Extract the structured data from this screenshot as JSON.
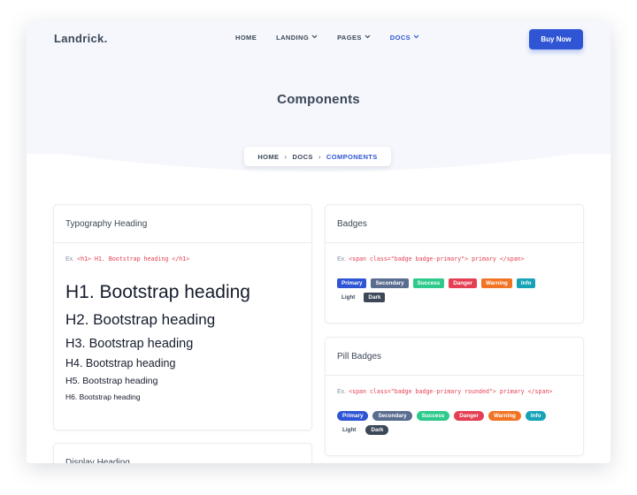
{
  "nav": {
    "logo": "Landrick.",
    "items": [
      {
        "label": "HOME",
        "dropdown": false,
        "active": false
      },
      {
        "label": "LANDING",
        "dropdown": true,
        "active": false
      },
      {
        "label": "PAGES",
        "dropdown": true,
        "active": false
      },
      {
        "label": "DOCS",
        "dropdown": true,
        "active": true
      }
    ],
    "cta": "Buy Now"
  },
  "page": {
    "title": "Components"
  },
  "breadcrumb": {
    "items": [
      "HOME",
      "DOCS",
      "COMPONENTS"
    ],
    "separator": "›"
  },
  "typography": {
    "title": "Typography Heading",
    "example_prefix": "Ex.",
    "example_code": "<h1> H1. Bootstrap heading </h1>",
    "headings": [
      "H1. Bootstrap heading",
      "H2. Bootstrap heading",
      "H3. Bootstrap heading",
      "H4. Bootstrap heading",
      "H5. Bootstrap heading",
      "H6. Bootstrap heading"
    ]
  },
  "display_card": {
    "title": "Display Heading"
  },
  "badges": {
    "title": "Badges",
    "example_prefix": "Ex.",
    "example_code": "<span class=\"badge badge-primary\"> primary </span>",
    "items": [
      {
        "label": "Primary",
        "color": "#2f55d4"
      },
      {
        "label": "Secondary",
        "color": "#5a6d90"
      },
      {
        "label": "Success",
        "color": "#2eca8b"
      },
      {
        "label": "Danger",
        "color": "#e43f52"
      },
      {
        "label": "Warning",
        "color": "#f17425"
      },
      {
        "label": "Info",
        "color": "#17a2b8"
      },
      {
        "label": "Light",
        "color": "transparent"
      },
      {
        "label": "Dark",
        "color": "#3c4858"
      }
    ]
  },
  "pill_badges": {
    "title": "Pill Badges",
    "example_prefix": "Ex.",
    "example_code": "<span class=\"badge badge-primary rounded\"> primary </span>",
    "items": [
      {
        "label": "Primary",
        "color": "#2f55d4"
      },
      {
        "label": "Secondary",
        "color": "#5a6d90"
      },
      {
        "label": "Success",
        "color": "#2eca8b"
      },
      {
        "label": "Danger",
        "color": "#e43f52"
      },
      {
        "label": "Warning",
        "color": "#f17425"
      },
      {
        "label": "Info",
        "color": "#17a2b8"
      },
      {
        "label": "Light",
        "color": "transparent"
      },
      {
        "label": "Dark",
        "color": "#3c4858"
      }
    ]
  },
  "colors": {
    "primary": "#2f55d4",
    "heading_text": "#3c4858",
    "code_text": "#e43f52",
    "hero_bg": "#f5f7fc"
  }
}
